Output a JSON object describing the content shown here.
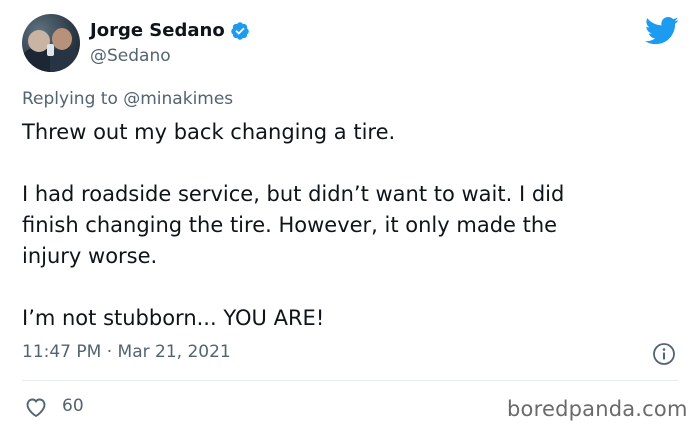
{
  "author": {
    "display_name": "Jorge Sedano",
    "handle": "@Sedano",
    "verified": true
  },
  "reply_context": {
    "prefix": "Replying to",
    "mention": "@minakimes"
  },
  "tweet_text": {
    "line1": "Threw out my back changing a tire.",
    "line2": "I had roadside service, but didn’t want to wait. I did",
    "line3": "finish changing the tire. However, it only made the",
    "line4": "injury worse.",
    "line5": "I’m not stubborn... YOU ARE!"
  },
  "meta": {
    "timestamp": "11:47 PM · Mar 21, 2021"
  },
  "engagement": {
    "likes": "60"
  },
  "watermark": {
    "text": "boredpanda.com"
  },
  "icons": {
    "platform_logo": "twitter-bird-icon",
    "verified_badge": "verified-badge-icon",
    "info": "info-icon",
    "like": "heart-icon"
  },
  "colors": {
    "twitter_blue": "#1d9bf0",
    "text_primary": "#0f1419",
    "text_secondary": "#536471"
  }
}
